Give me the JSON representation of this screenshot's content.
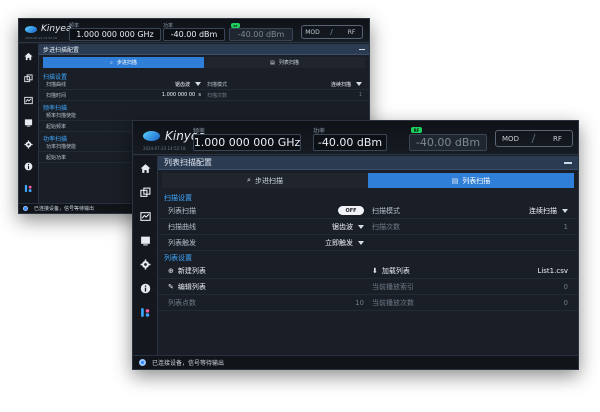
{
  "back": {
    "logo": "Kinyea",
    "logo_sub": "2024-07-23 14:52:18",
    "freq_label": "频率",
    "freq_value": "1.000 000 000 GHz",
    "amp_label": "功率",
    "amp_value": "-40.00 dBm",
    "rf_badge": "RF",
    "amp_ghost": "-40.00 dBm",
    "mod": "MOD",
    "rf": "RF",
    "panel_title": "步进扫描配置",
    "tab_step": "步进扫描",
    "tab_list": "列表扫描",
    "section_sweep": "扫描设置",
    "sweep_curve_label": "扫描曲线",
    "sweep_curve_value": "锯齿波",
    "sweep_mode_label": "扫描模式",
    "sweep_mode_value": "连续扫描",
    "sweep_time_label": "扫描时间",
    "sweep_time_value": "1.000 000 00",
    "sweep_time_unit": "s",
    "sweep_count_label": "扫描次数",
    "sweep_count_value": "1",
    "section_freq": "频率扫描",
    "freq_enable_label": "频率扫描使能",
    "start_freq_label": "起始频率",
    "section_power": "功率扫描",
    "power_enable_label": "功率扫描使能",
    "start_power_label": "起始功率",
    "status": "已连接设备，信号等待输出"
  },
  "front": {
    "logo": "Kinyea",
    "logo_sub": "2024-07-23 14:52:18",
    "freq_label": "频率",
    "freq_value": "1.000 000 000 GHz",
    "amp_label": "功率",
    "amp_value": "-40.00 dBm",
    "rf_badge": "RF",
    "amp_ghost": "-40.00 dBm",
    "mod": "MOD",
    "rf": "RF",
    "panel_title": "列表扫描配置",
    "tab_step": "步进扫描",
    "tab_list": "列表扫描",
    "section_sweep": "扫描设置",
    "list_sweep_label": "列表扫描",
    "list_sweep_toggle": "OFF",
    "sweep_mode_label": "扫描模式",
    "sweep_mode_value": "连续扫描",
    "sweep_curve_label": "扫描曲线",
    "sweep_curve_value": "锯齿波",
    "sweep_count_label": "扫描次数",
    "sweep_count_value": "1",
    "list_trigger_label": "列表触发",
    "list_trigger_value": "立即触发",
    "section_list": "列表设置",
    "new_list": "新建列表",
    "load_list": "加载列表",
    "load_list_value": "List1.csv",
    "edit_list": "编辑列表",
    "play_index_label": "当前播放索引",
    "play_index_value": "0",
    "list_points_label": "列表点数",
    "list_points_value": "10",
    "play_count_label": "当前播放次数",
    "play_count_value": "0",
    "status": "已连接设备，信号等待输出"
  },
  "colors": {
    "accent": "#2f7ed8",
    "section": "#3fa7ff",
    "rf_on": "#1fd15e",
    "background": "#1a1f27"
  },
  "icons": [
    "home-icon",
    "sweep-icon",
    "chart-icon",
    "window-icon",
    "gear-icon",
    "info-icon",
    "brand-icon"
  ]
}
